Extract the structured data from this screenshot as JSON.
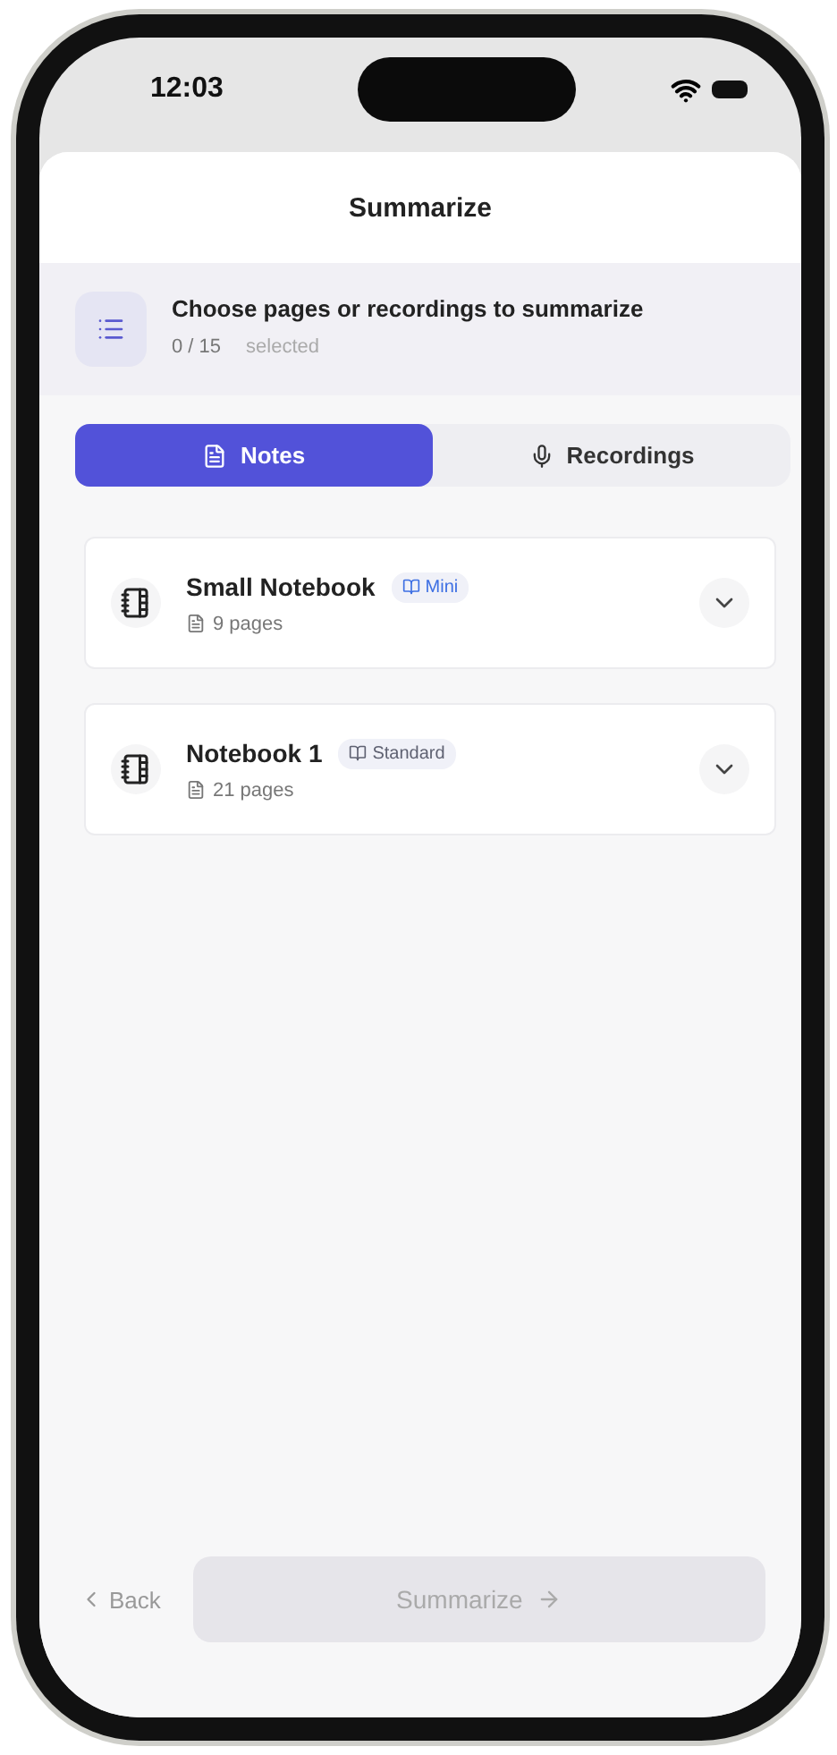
{
  "status_bar": {
    "time": "12:03"
  },
  "sheet": {
    "title": "Summarize"
  },
  "header": {
    "prompt": "Choose pages or recordings to summarize",
    "count": "0 / 15",
    "count_label": "selected"
  },
  "tabs": [
    {
      "label": "Notes",
      "kind": "notes",
      "selected": true
    },
    {
      "label": "Recordings",
      "kind": "recordings",
      "selected": false
    }
  ],
  "notebooks": [
    {
      "name": "Small Notebook",
      "tag": {
        "label": "Mini",
        "color": "#3d6fe3"
      },
      "pages": "9 pages",
      "expanded": false
    },
    {
      "name": "Notebook 1",
      "tag": {
        "label": "Standard",
        "color": "#5f6272"
      },
      "pages": "21 pages",
      "expanded": false
    }
  ],
  "footer": {
    "back": "Back",
    "summarize": {
      "label": "Summarize",
      "disabled": true
    }
  }
}
